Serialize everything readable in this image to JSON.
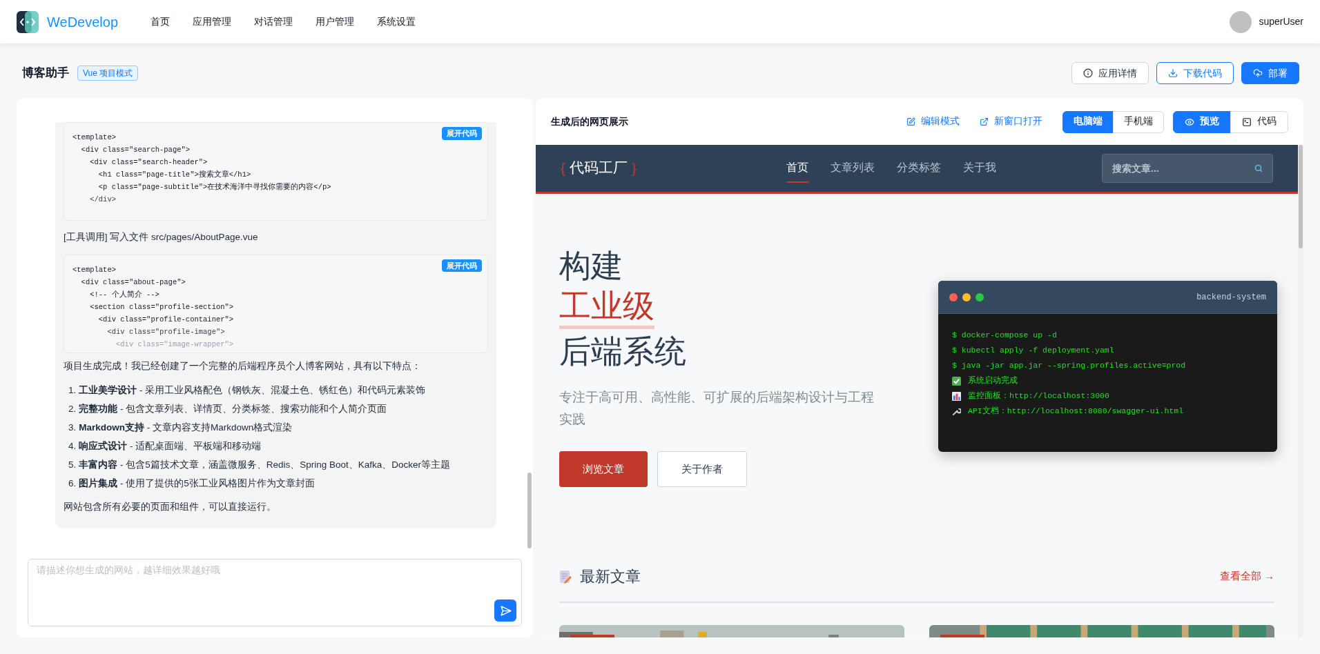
{
  "top_nav": {
    "brand": "WeDevelop",
    "items": [
      {
        "label": "首页"
      },
      {
        "label": "应用管理"
      },
      {
        "label": "对话管理"
      },
      {
        "label": "用户管理"
      },
      {
        "label": "系统设置"
      }
    ],
    "user": "superUser"
  },
  "app_header": {
    "title": "博客助手",
    "badge": "Vue 项目模式",
    "buttons": [
      {
        "label": "应用详情",
        "kind": "info"
      },
      {
        "label": "下载代码",
        "kind": "download"
      },
      {
        "label": "部署",
        "kind": "deploy"
      }
    ]
  },
  "chat": {
    "blocks": [
      {
        "kind": "code",
        "expanded": false,
        "action": "展开代码",
        "lines": [
          "<template>",
          "  <div class=\"search-page\">",
          "    <div class=\"search-header\">",
          "      <h1 class=\"page-title\">搜索文章</h1>",
          "      <p class=\"page-subtitle\">在技术海洋中寻找你需要的内容</p>",
          "    </div>"
        ]
      },
      {
        "kind": "tool_call",
        "text": "[工具调用] 写入文件 src/pages/AboutPage.vue"
      },
      {
        "kind": "code",
        "expanded": false,
        "action": "展开代码",
        "lines": [
          "<template>",
          "  <div class=\"about-page\">",
          "    <!-- 个人简介 -->",
          "    <section class=\"profile-section\">",
          "      <div class=\"profile-container\">",
          "        <div class=\"profile-image\">",
          "          <div class=\"image-wrapper\">"
        ]
      },
      {
        "kind": "text",
        "text": "项目生成完成！我已经创建了一个完整的后端程序员个人博客网站，具有以下特点："
      },
      {
        "kind": "list",
        "items": [
          {
            "number": "1.",
            "text": "**工业美学设计** - 采用工业风格配色（钢铁灰、混凝土色、锈红色）和代码元素装饰"
          },
          {
            "number": "2.",
            "text": "**完整功能** - 包含文章列表、详情页、分类标签、搜索功能和个人简介页面"
          },
          {
            "number": "3.",
            "text": "**Markdown支持** - 文章内容支持Markdown格式渲染"
          },
          {
            "number": "4.",
            "text": "**响应式设计** - 适配桌面端、平板端和移动端"
          },
          {
            "number": "5.",
            "text": "**丰富内容** - 包含5篇技术文章，涵盖微服务、Redis、Spring Boot、Kafka、Docker等主题"
          },
          {
            "number": "6.",
            "text": "**图片集成** - 使用了提供的5张工业风格图片作为文章封面"
          }
        ]
      },
      {
        "kind": "text",
        "text": "网站包含所有必要的页面和组件，可以直接运行。"
      }
    ],
    "input": {
      "placeholder": "请描述你想生成的网站，越详细效果越好哦"
    }
  },
  "preview": {
    "title": "生成后的网页展示",
    "actions": [
      {
        "label": "编辑模式",
        "kind": "edit"
      },
      {
        "label": "新窗口打开",
        "kind": "open"
      }
    ],
    "device_tabs": [
      {
        "label": "电脑端",
        "selected": true
      },
      {
        "label": "手机端",
        "selected": false
      }
    ],
    "view_tabs": [
      {
        "label": "预览",
        "kind": "preview",
        "selected": true
      },
      {
        "label": "代码",
        "kind": "code",
        "selected": false
      }
    ],
    "site": {
      "logo_open": "{",
      "logo": "代码工厂",
      "logo_close": "}",
      "nav": [
        {
          "label": "首页",
          "selected": true
        },
        {
          "label": "文章列表",
          "selected": false
        },
        {
          "label": "分类标签",
          "selected": false
        },
        {
          "label": "关于我",
          "selected": false
        }
      ],
      "search": {
        "placeholder": "搜索文章..."
      },
      "hero": {
        "lines": [
          {
            "text": "构建",
            "highlight": false
          },
          {
            "text": "工业级",
            "highlight": true
          },
          {
            "text": "后端系统",
            "highlight": false
          }
        ],
        "subtitle": "专注于高可用、高性能、可扩展的后端架构设计与工程实践",
        "buttons": [
          {
            "label": "浏览文章",
            "kind": "primary"
          },
          {
            "label": "关于作者",
            "kind": "secondary"
          }
        ]
      },
      "terminal": {
        "title": "backend-system",
        "lines": [
          {
            "kind": "command",
            "text": "$ docker-compose up -d"
          },
          {
            "kind": "command",
            "text": "$ kubectl apply -f deployment.yaml"
          },
          {
            "kind": "command",
            "text": "$ java -jar app.jar --spring.profiles.active=prod"
          },
          {
            "kind": "check",
            "text": "系统启动完成"
          },
          {
            "kind": "chart",
            "text": "监控面板：http://localhost:3000"
          },
          {
            "kind": "wrench",
            "text": "API文档：http://localhost:8080/swagger-ui.html"
          }
        ]
      },
      "section": {
        "title": "最新文章",
        "link": "查看全部 →"
      },
      "articles": [
        {
          "kind": "city"
        },
        {
          "kind": "scaffold"
        }
      ]
    }
  }
}
